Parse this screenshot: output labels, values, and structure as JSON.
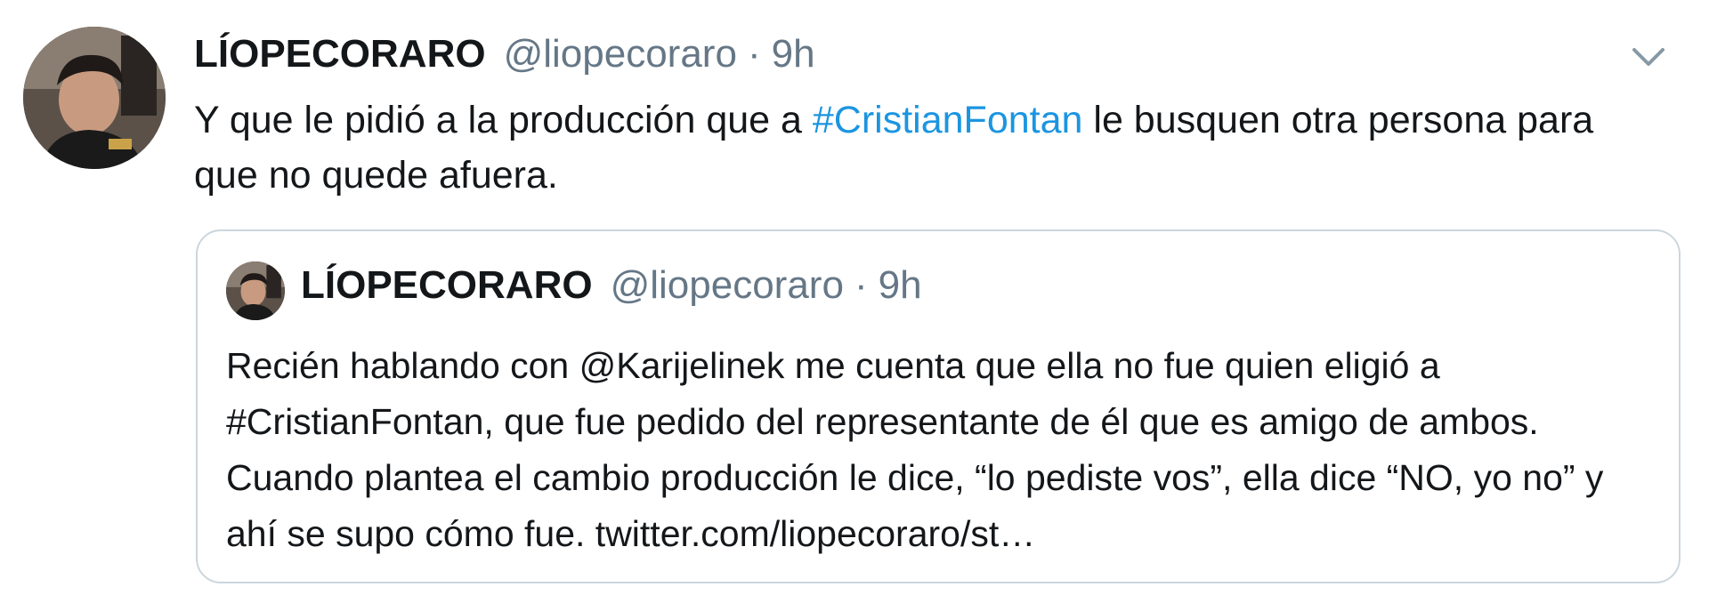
{
  "tweet": {
    "author_name": "LÍOPECORARO",
    "author_handle": "@liopecoraro",
    "separator": "·",
    "time": "9h",
    "text_before": "Y que le pidió a la producción que a ",
    "hashtag": "#CristianFontan",
    "text_after": " le busquen otra persona para que no quede afuera."
  },
  "quoted_tweet": {
    "author_name": "LÍOPECORARO",
    "author_handle": "@liopecoraro",
    "separator": "·",
    "time": "9h",
    "text": "Recién hablando con @Karijelinek me cuenta que ella no fue quien eligió a #CristianFontan, que fue pedido del representante de él que es amigo de ambos. Cuando plantea el cambio producción le dice, “lo pediste vos”, ella dice “NO, yo no” y ahí se supo cómo fue. twitter.com/liopecoraro/st…"
  },
  "icons": {
    "avatar": "user-avatar-photo",
    "caret": "chevron-down-icon"
  },
  "colors": {
    "hashtag": "#1b95e0",
    "secondary_text": "#657786",
    "primary_text": "#14171a",
    "border": "#ccd6dd"
  }
}
